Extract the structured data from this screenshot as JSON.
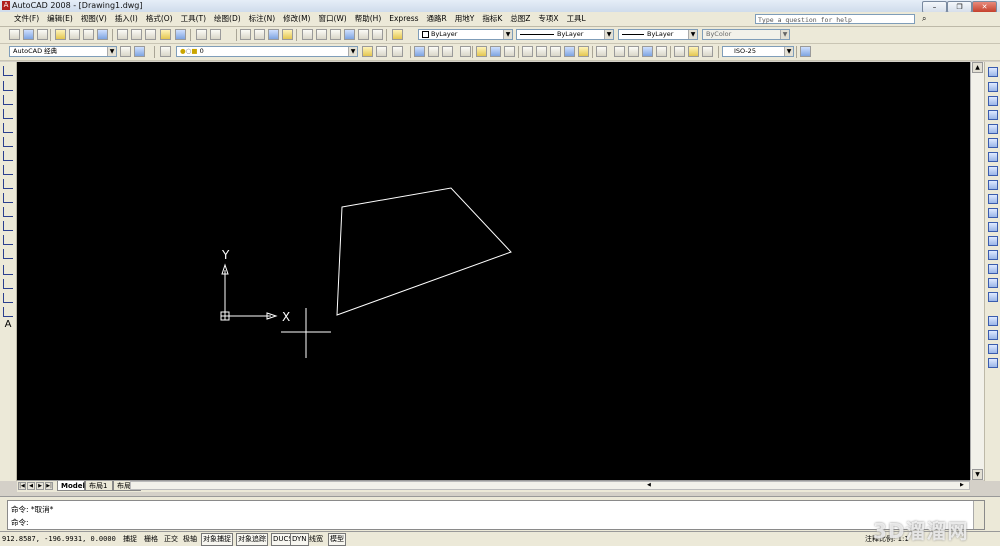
{
  "window": {
    "title": "AutoCAD 2008 - [Drawing1.dwg]",
    "app_icon": "A",
    "minimize_glyph": "–",
    "restore_glyph": "❐",
    "close_glyph": "✕",
    "close_color": "#c4402c"
  },
  "menu": {
    "items": [
      "文件(F)",
      "编辑(E)",
      "视图(V)",
      "插入(I)",
      "格式(O)",
      "工具(T)",
      "绘图(D)",
      "标注(N)",
      "修改(M)",
      "窗口(W)",
      "帮助(H)",
      "Express",
      "通路R",
      "用地Y",
      "指标K",
      "总图Z",
      "专项X",
      "工具L"
    ],
    "help_search_placeholder": "Type a question for help"
  },
  "toolbars": {
    "layer_color": "ByLayer",
    "linetype": "ByLayer",
    "lineweight": "ByLayer",
    "plot_style": "ByColor",
    "workspace": "AutoCAD 经典",
    "layer_name": "0",
    "dim_style": "ISO-25"
  },
  "canvas": {
    "background": "#000000",
    "ucs_x_label": "X",
    "ucs_y_label": "Y",
    "polygon_color": "#ffffff",
    "crosshair_color": "#ffffff"
  },
  "layout_tabs": [
    "Model",
    "布局1",
    "布局2"
  ],
  "active_tab": "Model",
  "command": {
    "history_line": "命令: *取消*",
    "prompt": "命令:"
  },
  "status": {
    "coordinates": "912.8587,  -196.9931, 0.0000",
    "toggles": [
      "捕捉",
      "栅格",
      "正交",
      "极轴",
      "对象捕捉",
      "对象追踪",
      "DUCS",
      "DYN",
      "线宽",
      "模型"
    ],
    "annotation_scale": "注释比例: 1:1"
  },
  "watermark_text": "3D溜溜网"
}
